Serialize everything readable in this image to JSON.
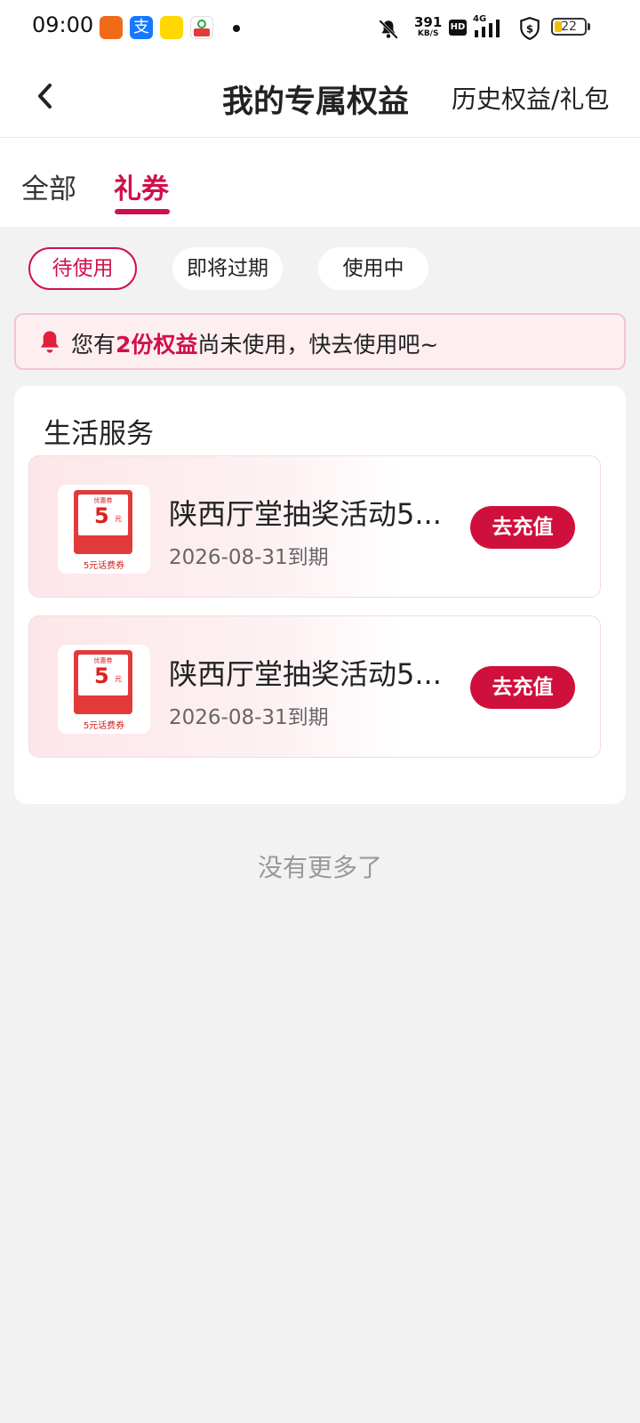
{
  "status_bar": {
    "time": "09:00",
    "net_speed_value": "391",
    "net_speed_unit": "KB/S",
    "hd_label": "HD",
    "network_label": "4G",
    "battery": "22"
  },
  "header": {
    "title": "我的专属权益",
    "right_link": "历史权益/礼包"
  },
  "tabs": [
    {
      "label": "全部",
      "active": false
    },
    {
      "label": "礼券",
      "active": true
    }
  ],
  "filters": [
    {
      "label": "待使用",
      "active": true
    },
    {
      "label": "即将过期",
      "active": false
    },
    {
      "label": "使用中",
      "active": false
    }
  ],
  "notice": {
    "prefix": "您有",
    "highlight": "2份权益",
    "suffix": "尚未使用，快去使用吧~"
  },
  "section": {
    "title": "生活服务",
    "coupons": [
      {
        "name": "陕西厅堂抽奖活动5...",
        "expiry": "2026-08-31到期",
        "button": "去充值",
        "image": {
          "label": "优惠券",
          "amount": "5",
          "unit": "元",
          "caption": "5元话费券"
        }
      },
      {
        "name": "陕西厅堂抽奖活动5...",
        "expiry": "2026-08-31到期",
        "button": "去充值",
        "image": {
          "label": "优惠券",
          "amount": "5",
          "unit": "元",
          "caption": "5元话费券"
        }
      }
    ]
  },
  "footer": {
    "no_more": "没有更多了"
  },
  "colors": {
    "accent": "#d0104c",
    "button": "#d0103c",
    "notice_bg": "#fdeef0",
    "page_bg": "#f2f2f2"
  }
}
